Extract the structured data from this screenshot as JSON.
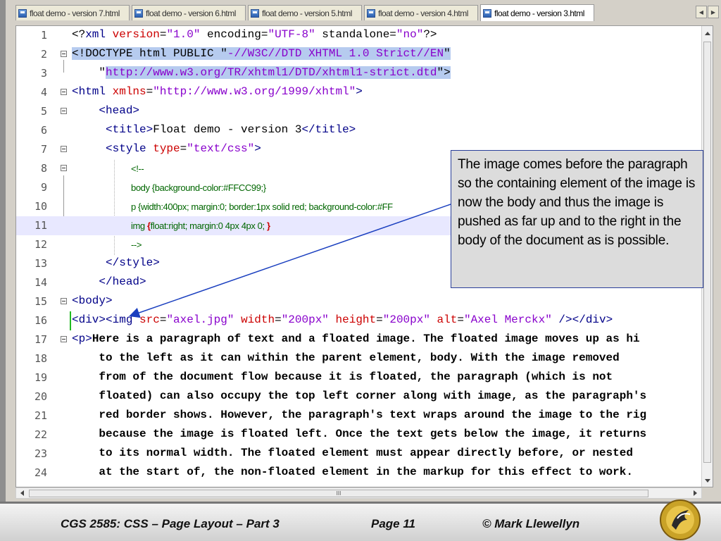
{
  "tabs": [
    {
      "label": "float demo - version 7.html",
      "active": false
    },
    {
      "label": "float demo - version 6.html",
      "active": false
    },
    {
      "label": "float demo - version 5.html",
      "active": false
    },
    {
      "label": "float demo - version 4.html",
      "active": false
    },
    {
      "label": "float demo - version 3.html",
      "active": true
    }
  ],
  "editor": {
    "lines": [
      {
        "n": "1"
      },
      {
        "n": "2"
      },
      {
        "n": "3"
      },
      {
        "n": "4"
      },
      {
        "n": "5"
      },
      {
        "n": "6"
      },
      {
        "n": "7"
      },
      {
        "n": "8"
      },
      {
        "n": "9"
      },
      {
        "n": "10"
      },
      {
        "n": "11"
      },
      {
        "n": "12"
      },
      {
        "n": "13"
      },
      {
        "n": "14"
      },
      {
        "n": "15"
      },
      {
        "n": "16"
      },
      {
        "n": "17"
      },
      {
        "n": "18"
      },
      {
        "n": "19"
      },
      {
        "n": "20"
      },
      {
        "n": "21"
      },
      {
        "n": "22"
      },
      {
        "n": "23"
      },
      {
        "n": "24"
      }
    ],
    "code": {
      "l1": [
        "<?",
        "xml ",
        "version",
        "=",
        "\"1.0\"",
        " encoding=",
        "\"UTF-8\"",
        " standalone=",
        "\"no\"",
        "?>"
      ],
      "l2": [
        "<!",
        "DOCTYPE html PUBLIC \"",
        "-//W3C//DTD XHTML 1.0 Strict//EN",
        "\""
      ],
      "l3": [
        "    \"",
        "http://www.w3.org/TR/xhtml1/DTD/xhtml1-strict.dtd",
        "\">"
      ],
      "l4": [
        "<html ",
        "xmlns",
        "=",
        "\"http://www.w3.org/1999/xhtml\"",
        ">"
      ],
      "l5": [
        "    <head>"
      ],
      "l6": [
        "     <title>",
        "Float demo - version 3",
        "</title>"
      ],
      "l7": [
        "     <style ",
        "type",
        "=",
        "\"text/css\"",
        ">"
      ],
      "l8": "<!--",
      "l9": "body {background-color:#FFCC99;}",
      "l10": "p {width:400px; margin:0; border:1px solid red; background-color:#FF",
      "l11": [
        "img ",
        "{",
        "float:right; margin:0 4px 4px 0; ",
        "}"
      ],
      "l12": "-->",
      "l13": "     </style>",
      "l14": "    </head>",
      "l15": "<body>",
      "l16": [
        "<div>",
        "<img ",
        "src",
        "=",
        "\"axel.jpg\"",
        " width",
        "=",
        "\"200px\"",
        " height",
        "=",
        "\"200px\"",
        " alt",
        "=",
        "\"Axel Merckx\"",
        " />",
        "</div>"
      ],
      "l17": [
        "<p>",
        "Here is a paragraph of text and a floated image. The floated image moves up as hi"
      ],
      "l18": "    to the left as it can within the parent element, body. With the image removed",
      "l19": "    from of the document flow because it is floated, the paragraph (which is not",
      "l20": "    floated) can also occupy the top left corner along with image, as the paragraph's",
      "l21": "    red border shows. However, the paragraph's text wraps around the image to the rig",
      "l22": "    because the image is floated left. Once the text gets below the image, it returns",
      "l23": "    to its normal width. The floated element must appear directly before, or nested",
      "l24": "    at the start of, the non-floated element in the markup for this effect to work."
    },
    "hscroll_grip": "III"
  },
  "callout": {
    "text": "The image comes before the paragraph so the containing element of the image is now the body and thus the image is pushed as far up and to the right in the body of the document as is possible."
  },
  "footer": {
    "course": "CGS 2585: CSS – Page Layout – Part 3",
    "page": "Page 11",
    "author": "© Mark Llewellyn"
  },
  "colors": {
    "tag": "#000088",
    "attr": "#cc0000",
    "value": "#8800cc",
    "selection": "#b6cbef",
    "callout_bg": "#dcdcdc",
    "callout_border": "#2a3f9a"
  }
}
